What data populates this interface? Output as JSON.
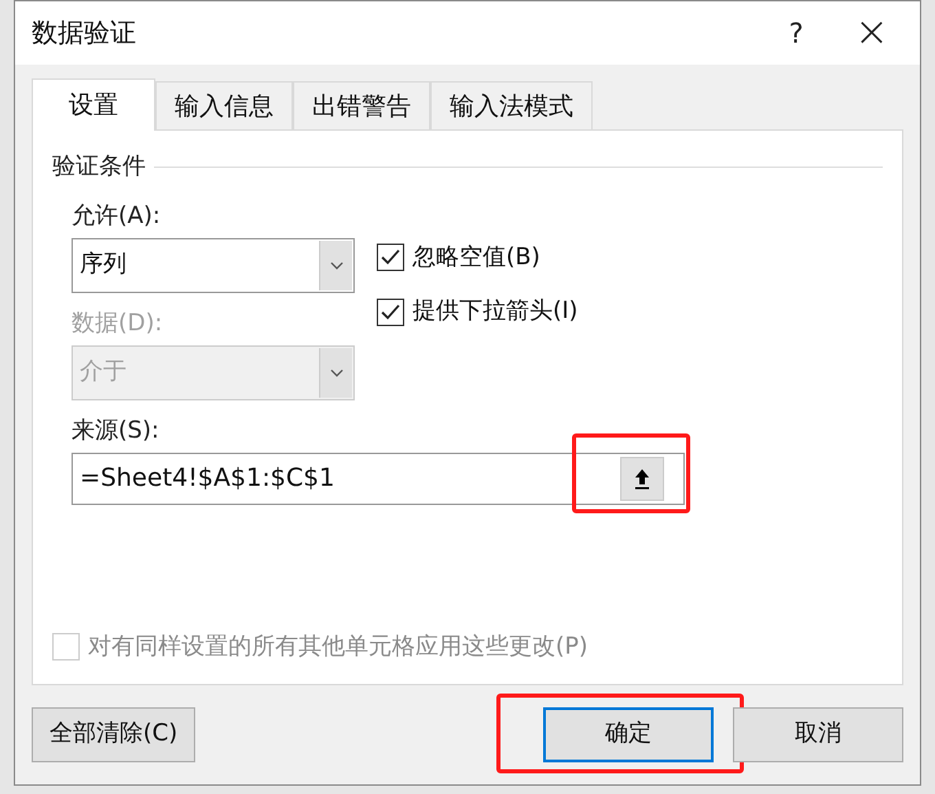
{
  "window": {
    "title": "数据验证",
    "help": "?",
    "close": "×"
  },
  "tabs": [
    {
      "label": "设置",
      "selected": true
    },
    {
      "label": "输入信息",
      "selected": false
    },
    {
      "label": "出错警告",
      "selected": false
    },
    {
      "label": "输入法模式",
      "selected": false
    }
  ],
  "section_title": "验证条件",
  "allow": {
    "label": "允许(A):",
    "value": "序列",
    "disabled": false
  },
  "data": {
    "label": "数据(D):",
    "value": "介于",
    "disabled": true
  },
  "options": [
    {
      "label": "忽略空值(B)",
      "checked": true
    },
    {
      "label": "提供下拉箭头(I)",
      "checked": true
    }
  ],
  "source": {
    "label": "来源(S):",
    "value": "=Sheet4!$A$1:$C$1",
    "highlighted": true
  },
  "apply_all": {
    "label": "对有同样设置的所有其他单元格应用这些更改(P)",
    "checked": false,
    "disabled": true
  },
  "buttons": [
    {
      "label": "全部清除(C)",
      "kind": "secondary",
      "highlighted": false
    },
    {
      "label": "确定",
      "kind": "default",
      "highlighted": true
    },
    {
      "label": "取消",
      "kind": "secondary",
      "highlighted": false
    }
  ]
}
